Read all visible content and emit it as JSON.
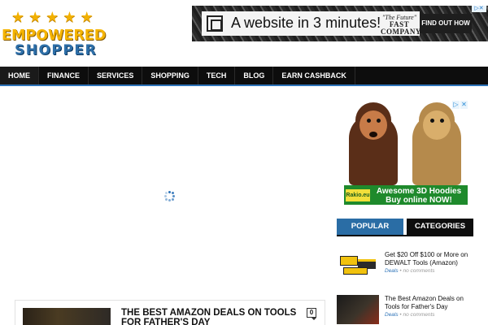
{
  "logo": {
    "stars": [
      "★",
      "★",
      "★",
      "★",
      "★"
    ],
    "line1": "EMPOWERED",
    "line2": "SHOPPER"
  },
  "header_ad": {
    "headline": "A website in 3 minutes!",
    "quote": "\"The Future\"",
    "publication": "FAST COMPANY",
    "cta": "FIND OUT HOW",
    "info": "▷✕"
  },
  "nav": {
    "items": [
      {
        "label": "HOME"
      },
      {
        "label": "FINANCE"
      },
      {
        "label": "SERVICES"
      },
      {
        "label": "SHOPPING"
      },
      {
        "label": "TECH"
      },
      {
        "label": "BLOG"
      },
      {
        "label": "EARN CASHBACK"
      }
    ]
  },
  "main": {
    "post": {
      "title": "THE BEST AMAZON DEALS ON TOOLS FOR FATHER'S DAY",
      "comments": "0"
    }
  },
  "sidebar": {
    "ad": {
      "info_icons": [
        "▷",
        "✕"
      ],
      "brand": "Rakio.eu",
      "text": "Awesome 3D Hoodies Buy online NOW!"
    },
    "tabs": [
      {
        "label": "POPULAR"
      },
      {
        "label": "CATEGORIES"
      }
    ],
    "posts": [
      {
        "title": "Get $20 Off $100 or More on DEWALT Tools (Amazon)",
        "category": "Deals",
        "separator": " • ",
        "comments": "no comments"
      },
      {
        "title": "The Best Amazon Deals on Tools for Father's Day",
        "category": "Deals",
        "separator": " • ",
        "comments": "no comments"
      }
    ]
  },
  "colors": {
    "nav_bg": "#0d0d0d",
    "accent_blue": "#2d73b8",
    "tab_popular": "#2a6da5",
    "logo_gold": "#f5b400",
    "ad_green": "#1e8a2c"
  }
}
